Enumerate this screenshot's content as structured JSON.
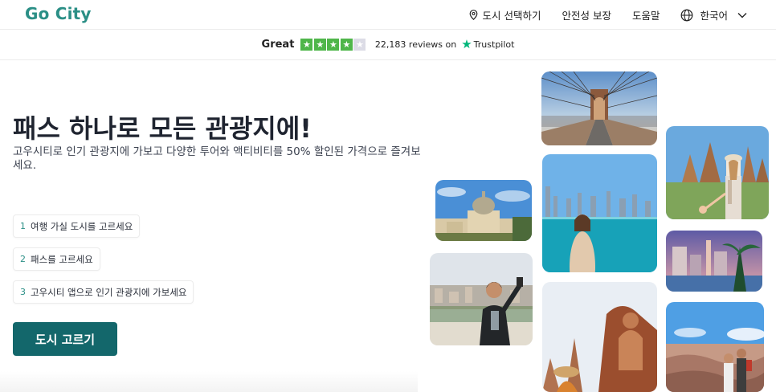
{
  "header": {
    "logo": "Go City",
    "nav": {
      "choose_city": "도시 선택하기",
      "safety": "안전성 보장",
      "help": "도움말",
      "language": "한국어"
    },
    "icons": [
      "location-pin-icon",
      "globe-icon",
      "chevron-down-icon"
    ]
  },
  "trust": {
    "rating_word": "Great",
    "stars_filled": 4,
    "stars_total": 5,
    "reviews": "22,183 reviews on",
    "provider": "Trustpilot",
    "colors": {
      "star_on": "#4fb64a",
      "star_off": "#dcdce6",
      "brand": "#00b67a"
    }
  },
  "hero": {
    "headline": "패스 하나로 모든 관광지에!",
    "subtext": "고우시티로 인기 관광지에 가보고 다양한 투어와 액티비티를 50% 할인된 가격으로 즐겨보세요.",
    "steps": [
      {
        "num": "1",
        "label": "여행 가실 도시를 고르세요"
      },
      {
        "num": "2",
        "label": "패스를 고르세요"
      },
      {
        "num": "3",
        "label": "고우시티 앱으로 인기 관광지에 가보세요"
      }
    ],
    "cta": "도시 고르기",
    "colors": {
      "brand": "#2b8f86",
      "cta_bg": "#13676b"
    }
  },
  "gallery": [
    {
      "name": "photo-brooklyn-bridge"
    },
    {
      "name": "photo-bangkok-temple"
    },
    {
      "name": "photo-london-st-pauls"
    },
    {
      "name": "photo-chicago-lake-woman"
    },
    {
      "name": "photo-las-vegas-strip"
    },
    {
      "name": "photo-barcelona-selfie-man"
    },
    {
      "name": "photo-bangkok-buddha-woman"
    },
    {
      "name": "photo-grand-canyon-couple"
    }
  ]
}
